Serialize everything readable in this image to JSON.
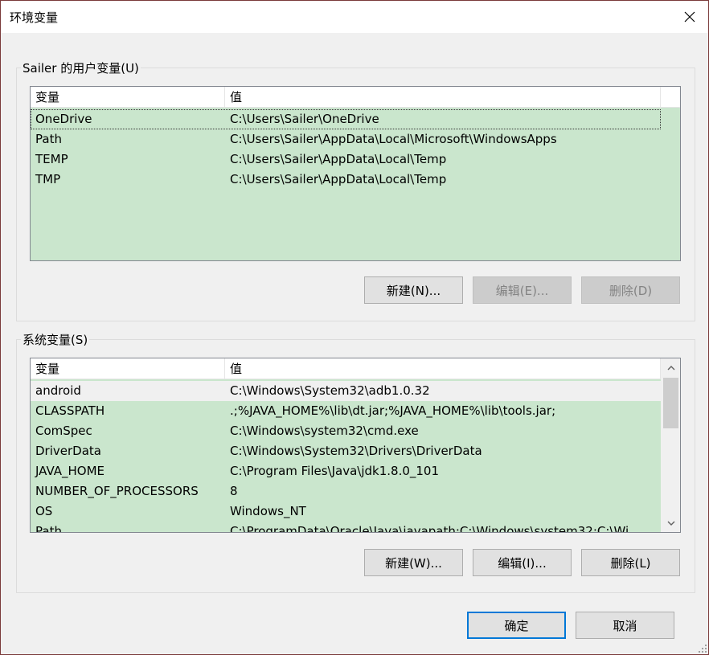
{
  "window": {
    "title": "环境变量"
  },
  "user_vars": {
    "group_label": "Sailer 的用户变量(U)",
    "headers": [
      "变量",
      "值"
    ],
    "rows": [
      {
        "name": "OneDrive",
        "value": "C:\\Users\\Sailer\\OneDrive"
      },
      {
        "name": "Path",
        "value": "C:\\Users\\Sailer\\AppData\\Local\\Microsoft\\WindowsApps"
      },
      {
        "name": "TEMP",
        "value": "C:\\Users\\Sailer\\AppData\\Local\\Temp"
      },
      {
        "name": "TMP",
        "value": "C:\\Users\\Sailer\\AppData\\Local\\Temp"
      }
    ],
    "buttons": {
      "new": "新建(N)...",
      "edit": "编辑(E)...",
      "delete": "删除(D)"
    }
  },
  "system_vars": {
    "group_label": "系统变量(S)",
    "headers": [
      "变量",
      "值"
    ],
    "rows": [
      {
        "name": "android",
        "value": "C:\\Windows\\System32\\adb1.0.32"
      },
      {
        "name": "CLASSPATH",
        "value": ".;%JAVA_HOME%\\lib\\dt.jar;%JAVA_HOME%\\lib\\tools.jar;"
      },
      {
        "name": "ComSpec",
        "value": "C:\\Windows\\system32\\cmd.exe"
      },
      {
        "name": "DriverData",
        "value": "C:\\Windows\\System32\\Drivers\\DriverData"
      },
      {
        "name": "JAVA_HOME",
        "value": "C:\\Program Files\\Java\\jdk1.8.0_101"
      },
      {
        "name": "NUMBER_OF_PROCESSORS",
        "value": "8"
      },
      {
        "name": "OS",
        "value": "Windows_NT"
      },
      {
        "name": "Path",
        "value": "C:\\ProgramData\\Oracle\\Java\\javapath;C:\\Windows\\system32;C:\\Wi"
      }
    ],
    "buttons": {
      "new": "新建(W)...",
      "edit": "编辑(I)...",
      "delete": "删除(L)"
    }
  },
  "footer": {
    "ok": "确定",
    "cancel": "取消"
  }
}
